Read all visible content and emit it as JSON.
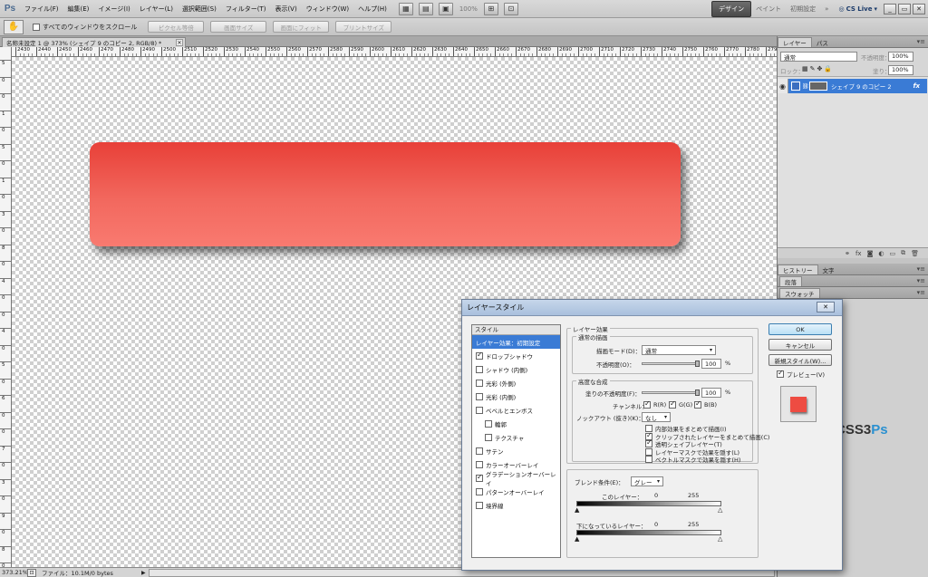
{
  "app": {
    "logo": "Ps"
  },
  "menubar": {
    "items": [
      "ファイル(F)",
      "編集(E)",
      "イメージ(I)",
      "レイヤー(L)",
      "選択範囲(S)",
      "フィルター(T)",
      "表示(V)",
      "ウィンドウ(W)",
      "ヘルプ(H)"
    ],
    "zoom": "100%",
    "workspace_active": "デザイン",
    "workspace_opts": [
      "ペイント",
      "初期設定"
    ],
    "workspace_more": "»",
    "cslive": "CS Live"
  },
  "options_bar": {
    "scroll_all_label": "すべてのウィンドウをスクロール",
    "scroll_all_checked": false,
    "buttons": [
      "ピクセル等倍",
      "画面サイズ",
      "画面にフィット",
      "プリントサイズ"
    ]
  },
  "document": {
    "tab_title": "名称未設定 1 @ 373% (シェイプ 9 のコピー 2, RGB/8) *",
    "shape_color_top": "#e84038",
    "shape_color_bottom": "#f97a70"
  },
  "ruler": {
    "h_labels": [
      "2430",
      "2440",
      "2450",
      "2460",
      "2470",
      "2480",
      "2490",
      "2500",
      "2510",
      "2520",
      "2530",
      "2540",
      "2550",
      "2560",
      "2570",
      "2580",
      "2590",
      "2600",
      "2610",
      "2620",
      "2630",
      "2640",
      "2650",
      "2660",
      "2670",
      "2680",
      "2690",
      "2700",
      "2710",
      "2720",
      "2730",
      "2740",
      "2750",
      "2760",
      "2770",
      "2780",
      "279"
    ],
    "v_labels": [
      "5",
      "0",
      "0",
      "1",
      "0",
      "5",
      "0",
      "1",
      "0",
      "3",
      "0",
      "8",
      "0",
      "4",
      "0",
      "0",
      "4",
      "0",
      "5",
      "0",
      "6",
      "0",
      "0",
      "7",
      "0",
      "3",
      "0",
      "9",
      "0",
      "8",
      "0"
    ]
  },
  "status": {
    "zoom": "373.21%",
    "file_info": "ファイル：10.1M/0 bytes",
    "arrow": "▶"
  },
  "panels": {
    "layers_tabs": [
      "レイヤー",
      "パス"
    ],
    "blend_mode": "通常",
    "opacity_label": "不透明度：",
    "opacity": "100%",
    "lock_label": "ロック：",
    "fill_label": "塗り：",
    "fill": "100%",
    "layer_name": "シェイプ 9 のコピー 2",
    "fx_label": "fx",
    "history_tabs": [
      "ヒストリー",
      "文字"
    ],
    "paragraph_tab": "段落",
    "swatch_tab": "スウォッチ",
    "menu_glyph": "▾≡"
  },
  "dialog": {
    "title": "レイヤースタイル",
    "close": "✕",
    "style_header": "スタイル",
    "styles": [
      {
        "label": "レイヤー効果：初期設定",
        "checkbox": false,
        "checked": false,
        "selected": true,
        "indent": false
      },
      {
        "label": "ドロップシャドウ",
        "checkbox": true,
        "checked": true,
        "selected": false,
        "indent": false
      },
      {
        "label": "シャドウ (内側)",
        "checkbox": true,
        "checked": false,
        "selected": false,
        "indent": false
      },
      {
        "label": "光彩 (外側)",
        "checkbox": true,
        "checked": false,
        "selected": false,
        "indent": false
      },
      {
        "label": "光彩 (内側)",
        "checkbox": true,
        "checked": false,
        "selected": false,
        "indent": false
      },
      {
        "label": "ベベルとエンボス",
        "checkbox": true,
        "checked": false,
        "selected": false,
        "indent": false
      },
      {
        "label": "輪郭",
        "checkbox": true,
        "checked": false,
        "selected": false,
        "indent": true
      },
      {
        "label": "テクスチャ",
        "checkbox": true,
        "checked": false,
        "selected": false,
        "indent": true
      },
      {
        "label": "サテン",
        "checkbox": true,
        "checked": false,
        "selected": false,
        "indent": false
      },
      {
        "label": "カラーオーバーレイ",
        "checkbox": true,
        "checked": false,
        "selected": false,
        "indent": false
      },
      {
        "label": "グラデーションオーバーレイ",
        "checkbox": true,
        "checked": true,
        "selected": false,
        "indent": false
      },
      {
        "label": "パターンオーバーレイ",
        "checkbox": true,
        "checked": false,
        "selected": false,
        "indent": false
      },
      {
        "label": "境界線",
        "checkbox": true,
        "checked": false,
        "selected": false,
        "indent": false
      }
    ],
    "effects_title": "レイヤー効果",
    "normal_title": "通常の描画",
    "blend_label": "描画モード(D)：",
    "blend_value": "通常",
    "opacity_label": "不透明度(O)：",
    "opacity_value": "100",
    "pct": "%",
    "advanced_title": "高度な合成",
    "fill_opacity_label": "塗りの不透明度(F)：",
    "fill_opacity_value": "100",
    "channels_label": "チャンネル：",
    "channels": [
      "R(R)",
      "G(G)",
      "B(B)"
    ],
    "knockout_label": "ノックアウト (抜き)(K)：",
    "knockout_value": "なし",
    "options": [
      {
        "label": "内部効果をまとめて描画(I)",
        "checked": false
      },
      {
        "label": "クリップされたレイヤーをまとめて描画(C)",
        "checked": true
      },
      {
        "label": "透明シェイプレイヤー(T)",
        "checked": true
      },
      {
        "label": "レイヤーマスクで効果を隠す(L)",
        "checked": false
      },
      {
        "label": "ベクトルマスクで効果を隠す(H)",
        "checked": false
      }
    ],
    "blendif_label": "ブレンド条件(E)：",
    "blendif_value": "グレー",
    "this_layer_label": "このレイヤー：",
    "underlying_label": "下になっているレイヤー：",
    "range_min": "0",
    "range_max": "255",
    "buttons": {
      "ok": "OK",
      "cancel": "キャンセル",
      "new_style": "新規スタイル(W)...",
      "preview": "プレビュー(V)"
    },
    "preview_checked": true
  },
  "watermark": {
    "text_a": "CSS3",
    "text_b": "Ps"
  }
}
